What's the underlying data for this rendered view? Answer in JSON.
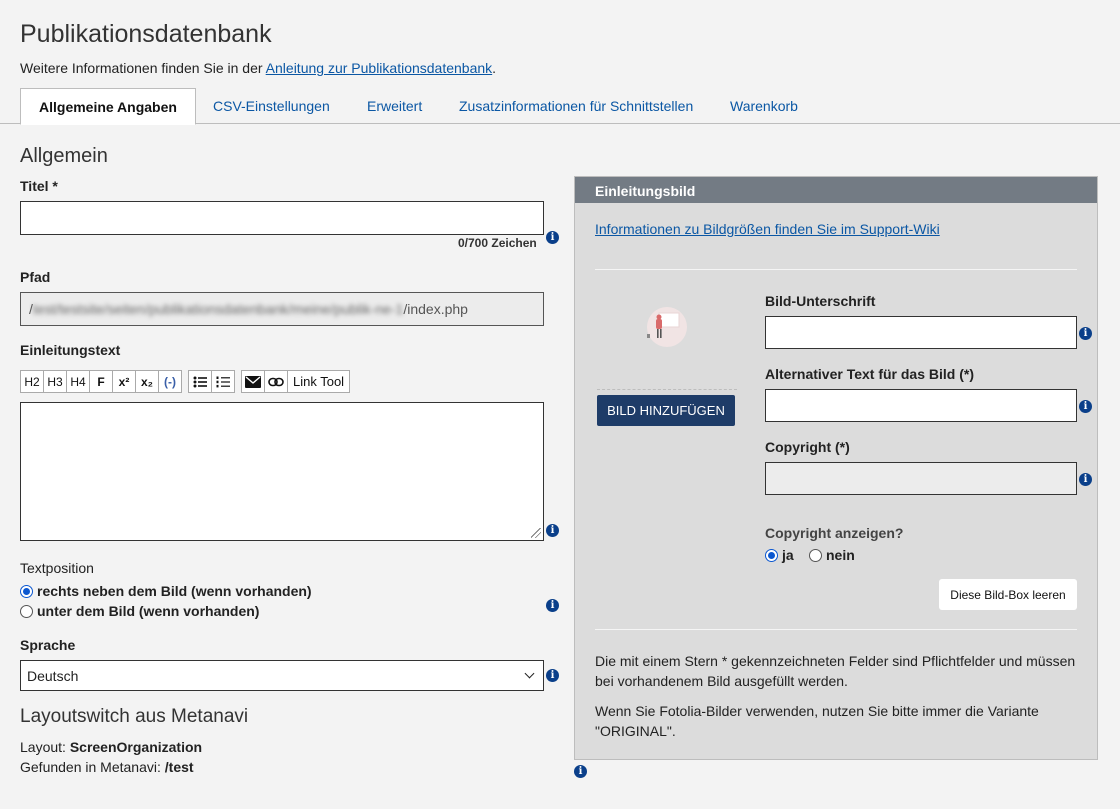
{
  "page": {
    "title": "Publikationsdatenbank",
    "intro_prefix": "Weitere Informationen finden Sie in der ",
    "intro_link": "Anleitung zur Publikationsdatenbank",
    "intro_suffix": "."
  },
  "tabs": [
    {
      "label": "Allgemeine Angaben",
      "active": true
    },
    {
      "label": "CSV-Einstellungen",
      "active": false
    },
    {
      "label": "Erweitert",
      "active": false
    },
    {
      "label": "Zusatzinformationen für Schnittstellen",
      "active": false
    },
    {
      "label": "Warenkorb",
      "active": false
    }
  ],
  "general": {
    "heading": "Allgemein",
    "title_label": "Titel *",
    "title_value": "",
    "title_counter": "0/700 Zeichen",
    "path_label": "Pfad",
    "path_prefix": "/",
    "path_blurred": "test/testsite/seiten/publikationsdatenbank/meine/publik-ne-1",
    "path_suffix": "/index.php",
    "intro_text_label": "Einleitungstext",
    "intro_text_value": "",
    "toolbar": {
      "h2": "H2",
      "h3": "H3",
      "h4": "H4",
      "bold": "F",
      "sup": "x²",
      "sub": "x₂",
      "abbr": "(-)",
      "ul_icon": "bulleted-list-icon",
      "ol_icon": "numbered-list-icon",
      "mail_icon": "envelope-icon",
      "link_icon": "link-icon",
      "link_tool": "Link Tool"
    },
    "textposition_label": "Textposition",
    "textposition_options": [
      {
        "label": "rechts neben dem Bild (wenn vorhanden)",
        "checked": true
      },
      {
        "label": "unter dem Bild (wenn vorhanden)",
        "checked": false
      }
    ],
    "language_label": "Sprache",
    "language_value": "Deutsch",
    "layoutswitch_heading": "Layoutswitch aus Metanavi",
    "layout_label": "Layout: ",
    "layout_value": "ScreenOrganization",
    "found_label": "Gefunden in Metanavi: ",
    "found_value": "/test"
  },
  "image_box": {
    "header": "Einleitungsbild",
    "info_link": "Informationen zu Bildgrößen finden Sie im Support-Wiki",
    "add_button": "BILD HINZUFÜGEN",
    "caption_label": "Bild-Unterschrift",
    "caption_value": "",
    "alt_label": "Alternativer Text für das Bild (*)",
    "alt_value": "",
    "copyright_label": "Copyright (*)",
    "copyright_value": "",
    "show_copyright_label": "Copyright anzeigen?",
    "show_copyright_options": [
      {
        "label": "ja",
        "checked": true
      },
      {
        "label": "nein",
        "checked": false
      }
    ],
    "clear_button": "Diese Bild-Box leeren",
    "note1": "Die mit einem Stern * gekennzeichneten Felder sind Pflichtfelder und müssen bei vorhandenem Bild ausgefüllt werden.",
    "note2": "Wenn Sie Fotolia-Bilder verwenden, nutzen Sie bitte immer die Variante \"ORIGINAL\"."
  },
  "icons": {
    "info": "i"
  },
  "colors": {
    "link": "#0b57a4",
    "panel_header": "#737b84",
    "primary_button": "#1e3c68",
    "info_icon": "#0a3f8a"
  }
}
